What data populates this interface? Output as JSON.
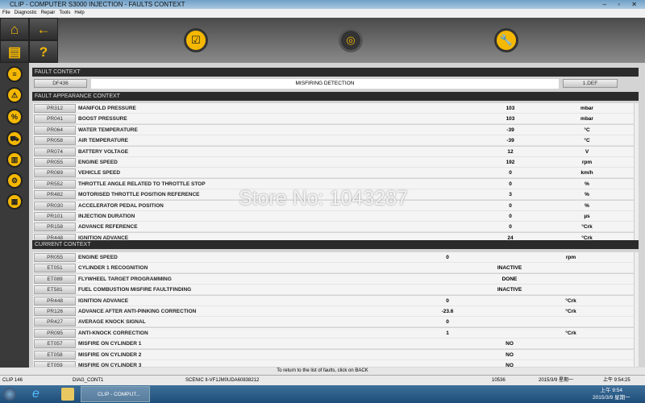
{
  "window": {
    "title": "CLIP - COMPUTER S3000 INJECTION - FAULTS CONTEXT",
    "controls": "– ▫ ✕"
  },
  "menu": [
    "File",
    "Diagnostic",
    "Repair",
    "Tools",
    "Help"
  ],
  "sidebar": {
    "home": "⌂",
    "back": "←",
    "print": "▤",
    "help": "?",
    "icons": [
      "≡",
      "⚠",
      "%",
      "⛟",
      "▥",
      "⚙",
      "▦"
    ]
  },
  "toolbar": {
    "icons": [
      "☑",
      "◎",
      "🔧"
    ]
  },
  "fault_context": {
    "header": "FAULT CONTEXT",
    "code": "DF436",
    "description": "MISFIRING DETECTION",
    "status": "1.DEF"
  },
  "appearance": {
    "header": "FAULT APPEARANCE CONTEXT",
    "rows": [
      {
        "code": "PR312",
        "name": "MANIFOLD PRESSURE",
        "value": "103",
        "unit": "mbar"
      },
      {
        "code": "PR041",
        "name": "BOOST PRESSURE",
        "value": "103",
        "unit": "mbar"
      },
      {
        "code": "PR064",
        "name": "WATER TEMPERATURE",
        "value": "-39",
        "unit": "°C"
      },
      {
        "code": "PR058",
        "name": "AIR TEMPERATURE",
        "value": "-39",
        "unit": "°C"
      },
      {
        "code": "PR074",
        "name": "BATTERY VOLTAGE",
        "value": "12",
        "unit": "V"
      },
      {
        "code": "PR055",
        "name": "ENGINE SPEED",
        "value": "192",
        "unit": "rpm"
      },
      {
        "code": "PR089",
        "name": "VEHICLE SPEED",
        "value": "0",
        "unit": "km/h"
      },
      {
        "code": "PR552",
        "name": "THROTTLE ANGLE RELATED TO THROTTLE STOP",
        "value": "0",
        "unit": "%"
      },
      {
        "code": "PR482",
        "name": "MOTORISED THROTTLE POSITION REFERENCE",
        "value": "3",
        "unit": "%"
      },
      {
        "code": "PR030",
        "name": "ACCELERATOR PEDAL POSITION",
        "value": "0",
        "unit": "%"
      },
      {
        "code": "PR101",
        "name": "INJECTION DURATION",
        "value": "0",
        "unit": "µs"
      },
      {
        "code": "PR158",
        "name": "ADVANCE REFERENCE",
        "value": "0",
        "unit": "°Crk"
      },
      {
        "code": "PR448",
        "name": "IGNITION ADVANCE",
        "value": "24",
        "unit": "°Crk"
      }
    ]
  },
  "current": {
    "header": "CURRENT CONTEXT",
    "rows": [
      {
        "code": "PR055",
        "name": "ENGINE SPEED",
        "num": "0",
        "state": "",
        "unit": "rpm"
      },
      {
        "code": "ET051",
        "name": "CYLINDER 1 RECOGNITION",
        "num": "",
        "state": "INACTIVE",
        "unit": ""
      },
      {
        "code": "ET089",
        "name": "FLYWHEEL TARGET PROGRAMMING",
        "num": "",
        "state": "DONE",
        "unit": ""
      },
      {
        "code": "ET581",
        "name": "FUEL COMBUSTION MISFIRE FAULTFINDING",
        "num": "",
        "state": "INACTIVE",
        "unit": ""
      },
      {
        "code": "PR448",
        "name": "IGNITION ADVANCE",
        "num": "0",
        "state": "",
        "unit": "°Crk"
      },
      {
        "code": "PR126",
        "name": "ADVANCE AFTER ANTI-PINKING CORRECTION",
        "num": "-23.6",
        "state": "",
        "unit": "°Crk"
      },
      {
        "code": "PR427",
        "name": "AVERAGE KNOCK SIGNAL",
        "num": "0",
        "state": "",
        "unit": ""
      },
      {
        "code": "PR095",
        "name": "ANTI-KNOCK CORRECTION",
        "num": "1",
        "state": "",
        "unit": "°Crk"
      },
      {
        "code": "ET057",
        "name": "MISFIRE ON CYLINDER 1",
        "num": "",
        "state": "NO",
        "unit": ""
      },
      {
        "code": "ET058",
        "name": "MISFIRE ON CYLINDER 2",
        "num": "",
        "state": "NO",
        "unit": ""
      },
      {
        "code": "ET059",
        "name": "MISFIRE ON CYLINDER 3",
        "num": "",
        "state": "NO",
        "unit": ""
      }
    ]
  },
  "watermark": "Store No: 1043287",
  "hint": "To return to the list of faults, click on BACK",
  "status": {
    "clip": "CLIP 146",
    "diag": "DIAG_CONT1",
    "vehicle": "SCENIC II-VF1JM0UDA60838212",
    "count": "10536",
    "date": "2015/3/9 星期一",
    "time": "上午 9:54:25"
  },
  "taskbar": {
    "app": "CLIP - COMPUT...",
    "time": "上午 9:54",
    "date": "2015/3/9 星期一"
  }
}
